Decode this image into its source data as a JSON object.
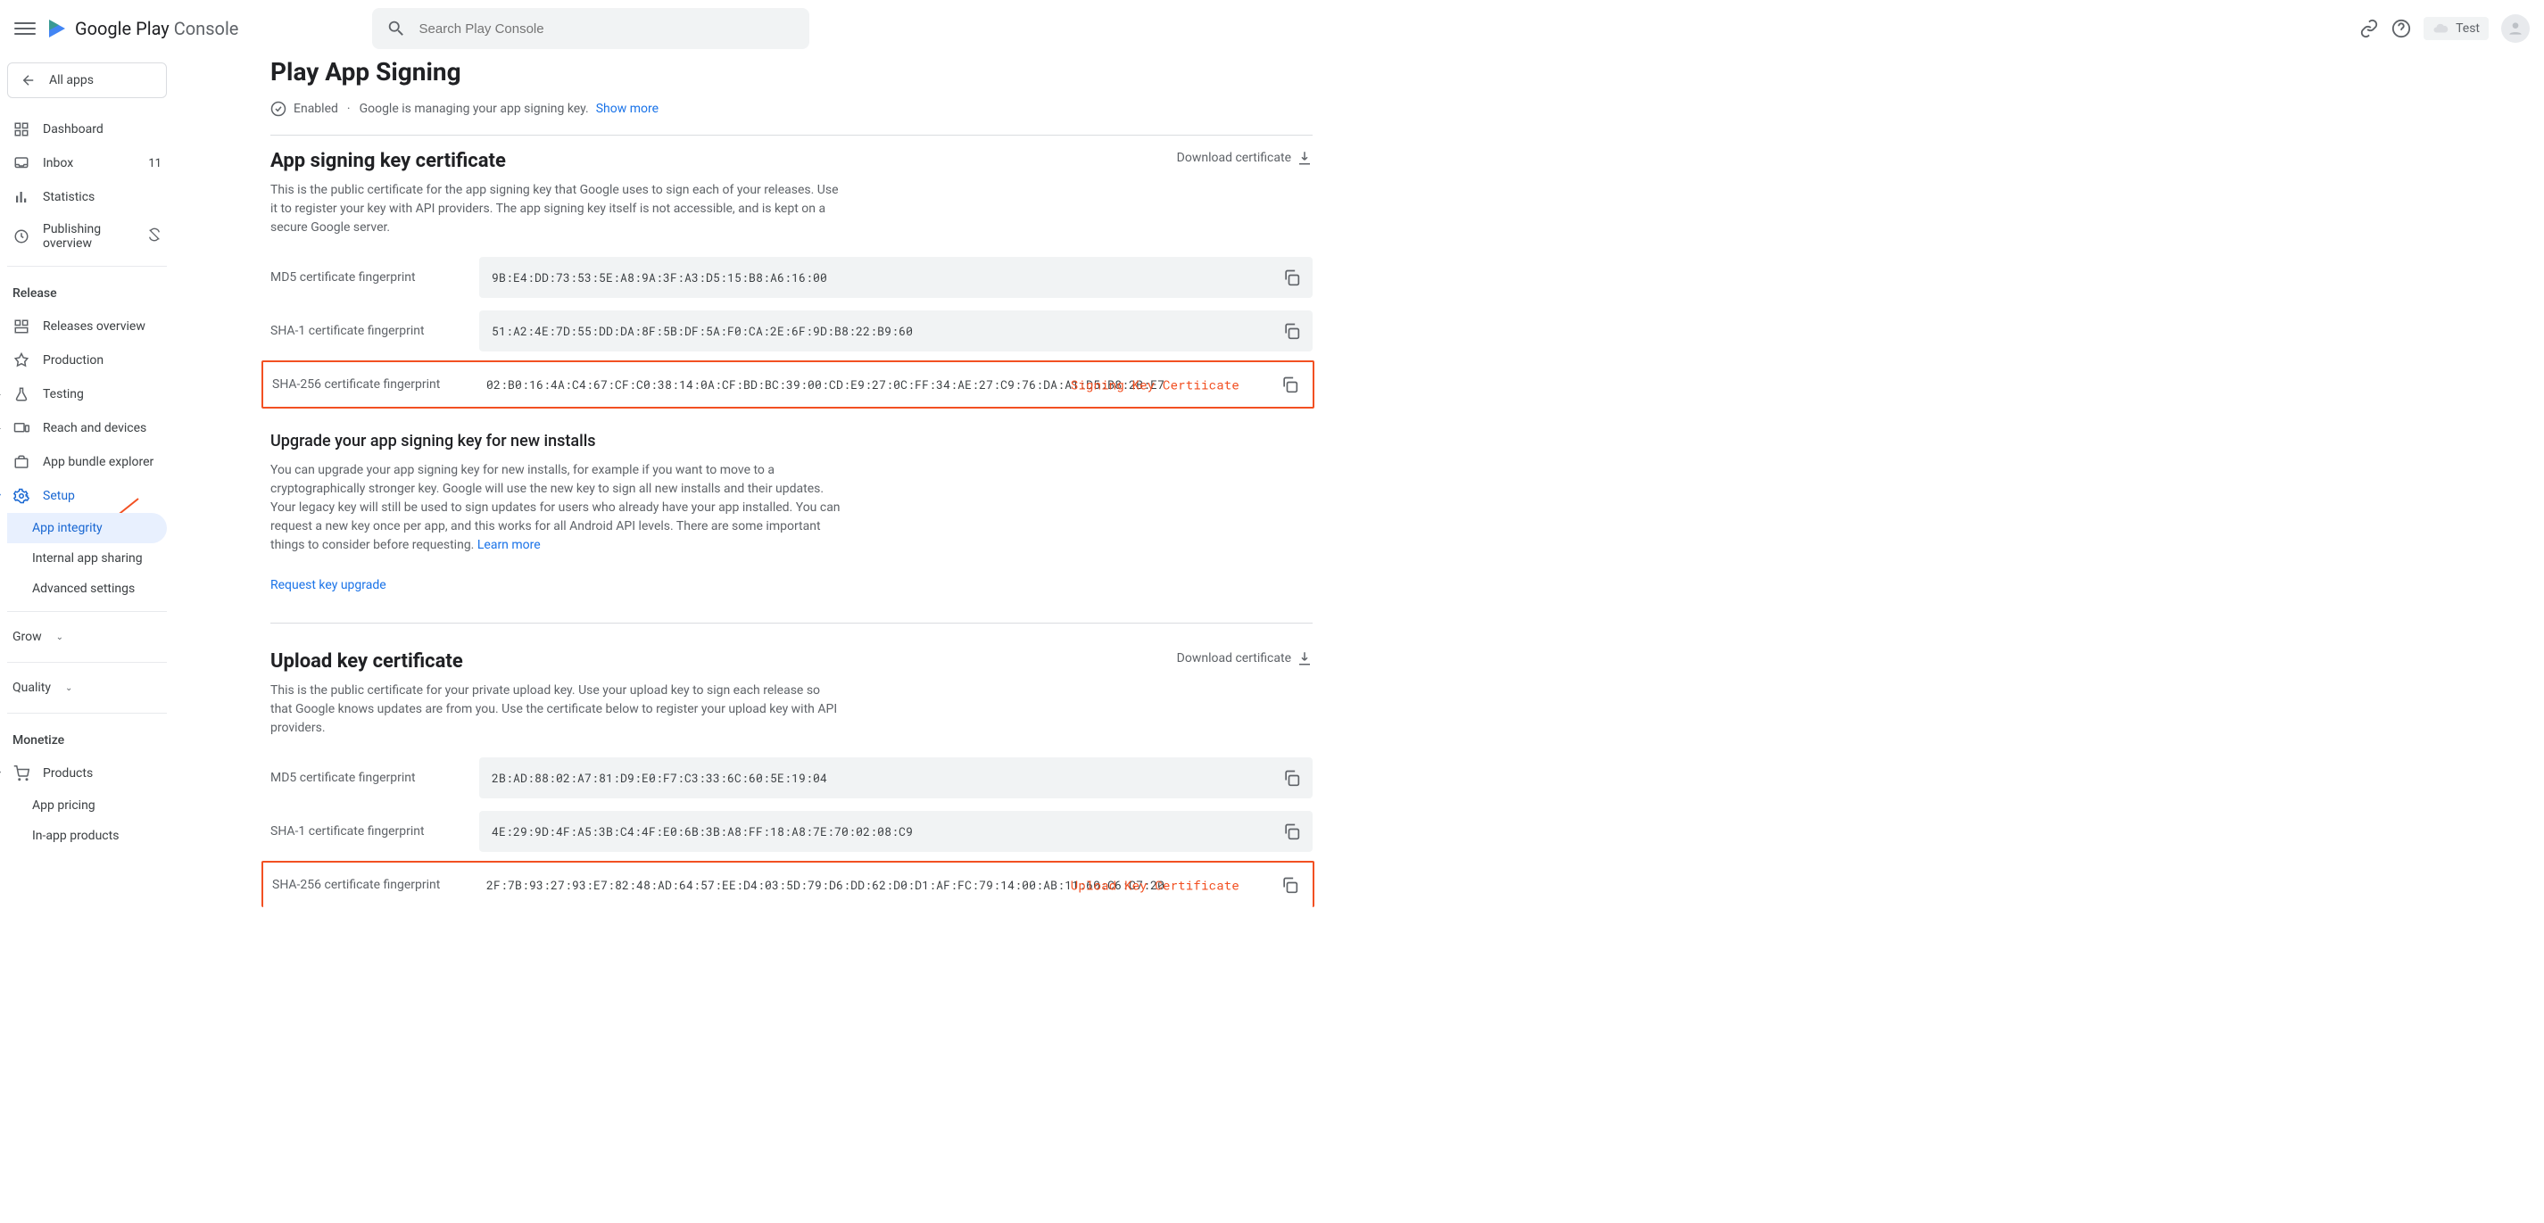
{
  "header": {
    "logo_text_bold": "Google Play",
    "logo_text_light": " Console",
    "search_placeholder": "Search Play Console",
    "test_label": "Test"
  },
  "sidebar": {
    "all_apps": "All apps",
    "items": [
      {
        "icon": "dashboard",
        "label": "Dashboard"
      },
      {
        "icon": "inbox",
        "label": "Inbox",
        "count": "11"
      },
      {
        "icon": "stats",
        "label": "Statistics"
      },
      {
        "icon": "publish",
        "label": "Publishing overview",
        "trailing": "sync-off"
      }
    ],
    "release_section": "Release",
    "release_items": [
      {
        "icon": "releases",
        "label": "Releases overview"
      },
      {
        "icon": "prod",
        "label": "Production"
      },
      {
        "icon": "testing",
        "label": "Testing",
        "expandable": true
      },
      {
        "icon": "reach",
        "label": "Reach and devices",
        "expandable": true
      },
      {
        "icon": "bundle",
        "label": "App bundle explorer"
      },
      {
        "icon": "setup",
        "label": "Setup",
        "blue": true,
        "expandable": true
      }
    ],
    "setup_sub": [
      {
        "label": "App integrity",
        "active": true
      },
      {
        "label": "Internal app sharing"
      },
      {
        "label": "Advanced settings"
      }
    ],
    "grow_section": "Grow",
    "quality_section": "Quality",
    "monetize_section": "Monetize",
    "monetize_items": [
      {
        "icon": "cart",
        "label": "Products",
        "expandable": true
      }
    ],
    "monetize_sub": [
      {
        "label": "App pricing"
      },
      {
        "label": "In-app products"
      }
    ]
  },
  "main": {
    "page_title": "Play App Signing",
    "status_enabled": "Enabled",
    "status_desc": "Google is managing your app signing key.",
    "show_more": "Show more",
    "app_signing": {
      "title": "App signing key certificate",
      "desc": "This is the public certificate for the app signing key that Google uses to sign each of your releases. Use it to register your key with API providers. The app signing key itself is not accessible, and is kept on a secure Google server.",
      "download": "Download certificate",
      "fps": [
        {
          "label": "MD5 certificate fingerprint",
          "value": "9B:E4:DD:73:53:5E:A8:9A:3F:A3:D5:15:B8:A6:16:00"
        },
        {
          "label": "SHA-1 certificate fingerprint",
          "value": "51:A2:4E:7D:55:DD:DA:8F:5B:DF:5A:F0:CA:2E:6F:9D:B8:22:B9:60"
        },
        {
          "label": "SHA-256 certificate fingerprint",
          "value": "02:B0:16:4A:C4:67:CF:C0:38:14:0A:CF:BD:BC:39:00:CD:E9:27:0C:FF:34:AE:27:C9:76:DA:A1:D5:B8:2B:E7",
          "annot": "Signing Key Certiicate"
        }
      ]
    },
    "upgrade": {
      "title": "Upgrade your app signing key for new installs",
      "desc": "You can upgrade your app signing key for new installs, for example if you want to move to a cryptographically stronger key. Google will use the new key to sign all new installs and their updates. Your legacy key will still be used to sign updates for users who already have your app installed. You can request a new key once per app, and this works for all Android API levels. There are some important things to consider before requesting. ",
      "learn_more": "Learn more",
      "request": "Request key upgrade"
    },
    "upload_key": {
      "title": "Upload key certificate",
      "desc": "This is the public certificate for your private upload key. Use your upload key to sign each release so that Google knows updates are from you. Use the certificate below to register your upload key with API providers.",
      "download": "Download certificate",
      "fps": [
        {
          "label": "MD5 certificate fingerprint",
          "value": "2B:AD:88:02:A7:81:D9:E0:F7:C3:33:6C:60:5E:19:04"
        },
        {
          "label": "SHA-1 certificate fingerprint",
          "value": "4E:29:9D:4F:A5:3B:C4:4F:E0:6B:3B:A8:FF:18:A8:7E:70:02:08:C9"
        },
        {
          "label": "SHA-256 certificate fingerprint",
          "value": "2F:7B:93:27:93:E7:82:48:AD:64:57:EE:D4:03:5D:79:D6:DD:62:D0:D1:AF:FC:79:14:00:AB:11:60:C6:C7:20",
          "annot": "Upload Key Certificate"
        }
      ]
    }
  }
}
